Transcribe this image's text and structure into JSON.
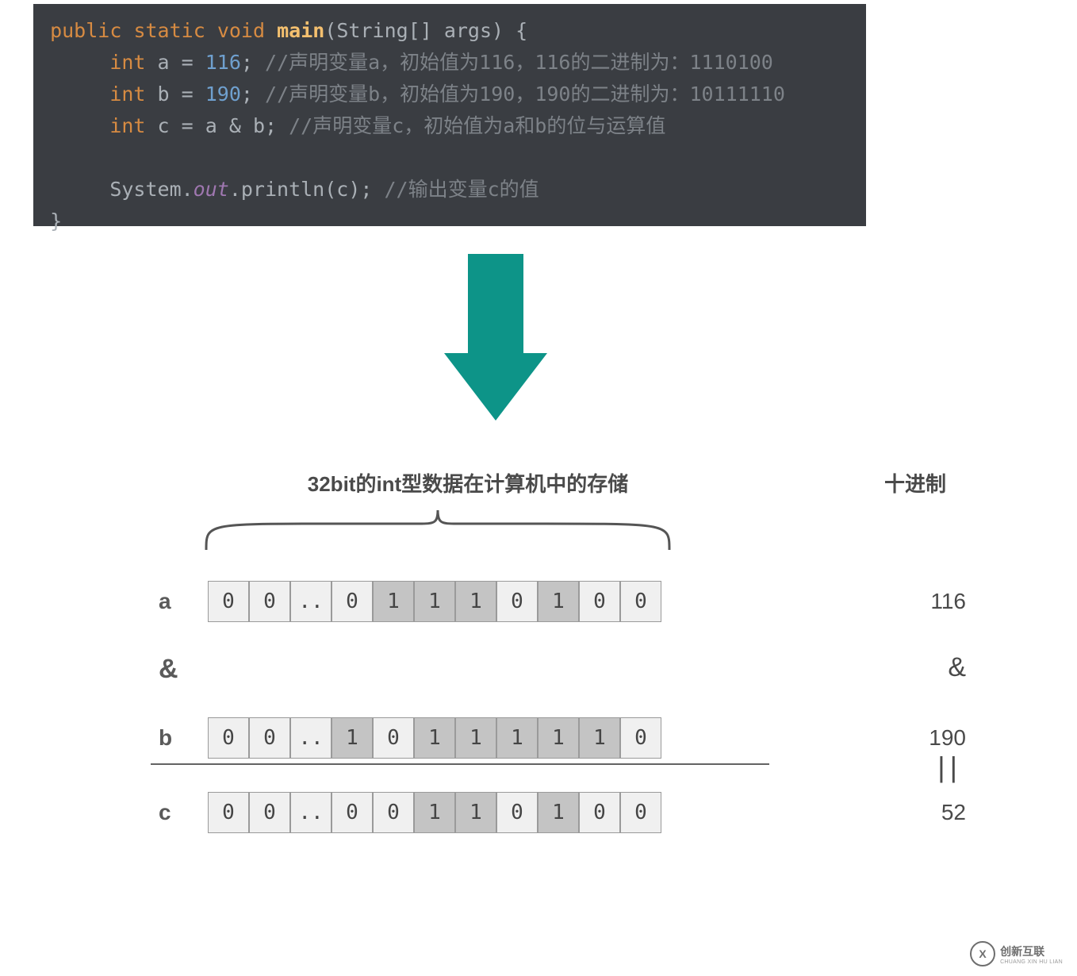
{
  "code": {
    "l1": {
      "kw1": "public",
      "kw2": "static",
      "kw3": "void",
      "fn": "main",
      "args": "(String[] args) {"
    },
    "l2": {
      "type": "int",
      "decl": "a = ",
      "val": "116",
      "semi": ";",
      "cm": " //声明变量a，初始值为116，116的二进制为：1110100"
    },
    "l3": {
      "type": "int",
      "decl": "b = ",
      "val": "190",
      "semi": ";",
      "cm": " //声明变量b，初始值为190，190的二进制为：10111110"
    },
    "l4": {
      "type": "int",
      "decl": "c = a & b;",
      "cm": " //声明变量c，初始值为a和b的位与运算值"
    },
    "l5": {
      "pre": "System.",
      "out": "out",
      "post": ".println(c);",
      "cm": " //输出变量c的值"
    },
    "l6": "}"
  },
  "diagram": {
    "title": "32bit的int型数据在计算机中的存储",
    "dec_label": "十进制",
    "rows": {
      "a": {
        "label": "a",
        "bits": [
          "0",
          "0",
          "..",
          "0",
          "1",
          "1",
          "1",
          "0",
          "1",
          "0",
          "0"
        ],
        "value": "116"
      },
      "op": {
        "label": "&",
        "value": "&"
      },
      "b": {
        "label": "b",
        "bits": [
          "0",
          "0",
          "..",
          "1",
          "0",
          "1",
          "1",
          "1",
          "1",
          "1",
          "0"
        ],
        "value": "190"
      },
      "eq": "||",
      "c": {
        "label": "c",
        "bits": [
          "0",
          "0",
          "..",
          "0",
          "0",
          "1",
          "1",
          "0",
          "1",
          "0",
          "0"
        ],
        "value": "52"
      }
    }
  },
  "watermark": {
    "logo": "X",
    "name": "创新互联",
    "sub": "CHUANG XIN HU LIAN"
  }
}
